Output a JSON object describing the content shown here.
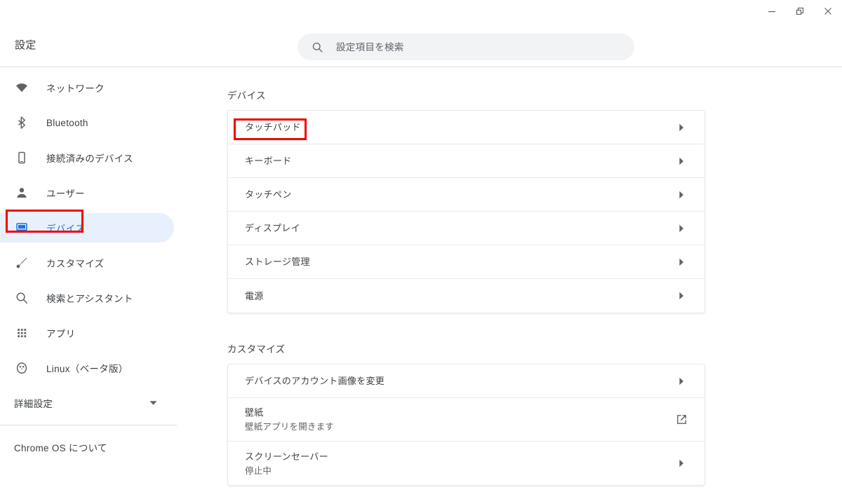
{
  "window": {
    "minimize_label": "最小化",
    "restore_label": "元のサイズに戻す",
    "close_label": "閉じる"
  },
  "header": {
    "title": "設定",
    "search_placeholder": "設定項目を検索",
    "search_value": ""
  },
  "sidebar": {
    "items": [
      {
        "id": "network",
        "label": "ネットワーク",
        "icon": "wifi-icon",
        "selected": false
      },
      {
        "id": "bluetooth",
        "label": "Bluetooth",
        "icon": "bluetooth-icon",
        "selected": false
      },
      {
        "id": "connected",
        "label": "接続済みのデバイス",
        "icon": "phone-icon",
        "selected": false
      },
      {
        "id": "users",
        "label": "ユーザー",
        "icon": "person-icon",
        "selected": false
      },
      {
        "id": "device",
        "label": "デバイス",
        "icon": "laptop-icon",
        "selected": true
      },
      {
        "id": "customize",
        "label": "カスタマイズ",
        "icon": "brush-icon",
        "selected": false
      },
      {
        "id": "search",
        "label": "検索とアシスタント",
        "icon": "search-icon",
        "selected": false
      },
      {
        "id": "apps",
        "label": "アプリ",
        "icon": "apps-grid-icon",
        "selected": false
      },
      {
        "id": "linux",
        "label": "Linux（ベータ版）",
        "icon": "penguin-icon",
        "selected": false
      }
    ],
    "advanced_label": "詳細設定",
    "about_label": "Chrome OS について"
  },
  "main": {
    "sections": [
      {
        "id": "device",
        "title": "デバイス",
        "rows": [
          {
            "label": "タッチパッド",
            "sub": "",
            "action": "chevron-right-icon",
            "annotated": true
          },
          {
            "label": "キーボード",
            "sub": "",
            "action": "chevron-right-icon",
            "annotated": false
          },
          {
            "label": "タッチペン",
            "sub": "",
            "action": "chevron-right-icon",
            "annotated": false
          },
          {
            "label": "ディスプレイ",
            "sub": "",
            "action": "chevron-right-icon",
            "annotated": false
          },
          {
            "label": "ストレージ管理",
            "sub": "",
            "action": "chevron-right-icon",
            "annotated": false
          },
          {
            "label": "電源",
            "sub": "",
            "action": "chevron-right-icon",
            "annotated": false
          }
        ]
      },
      {
        "id": "customize",
        "title": "カスタマイズ",
        "rows": [
          {
            "label": "デバイスのアカウント画像を変更",
            "sub": "",
            "action": "chevron-right-icon",
            "annotated": false
          },
          {
            "label": "壁紙",
            "sub": "壁紙アプリを開きます",
            "action": "external-link-icon",
            "annotated": false
          },
          {
            "label": "スクリーンセーバー",
            "sub": "停止中",
            "action": "chevron-right-icon",
            "annotated": false
          }
        ]
      }
    ]
  },
  "annotations": {
    "color": "#ee0000",
    "targets": [
      "sidebar-item-device",
      "row-touchpad"
    ]
  },
  "colors": {
    "accent": "#1a73e8",
    "selected_pill": "#e8f0fe",
    "text_primary": "#3c4043",
    "text_secondary": "#5f6368",
    "border": "#e8eaed",
    "search_bg": "#f1f3f4"
  }
}
